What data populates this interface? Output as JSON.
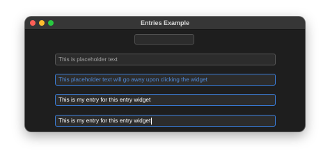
{
  "window": {
    "title": "Entries Example"
  },
  "entries": [
    {
      "text": "",
      "kind": "empty"
    },
    {
      "text": "This is placeholder text",
      "kind": "placeholder"
    },
    {
      "text": "This placeholder text will go away upon clicking the widget",
      "kind": "placeholder-highlighted"
    },
    {
      "text": "This is my entry for this entry widget",
      "kind": "value"
    },
    {
      "text": "This is my entry for this entry widget",
      "kind": "value-focused"
    }
  ],
  "colors": {
    "window_bg": "#1e1e1e",
    "accent": "#3a7bd5",
    "placeholder_highlight": "#4f88d6"
  }
}
